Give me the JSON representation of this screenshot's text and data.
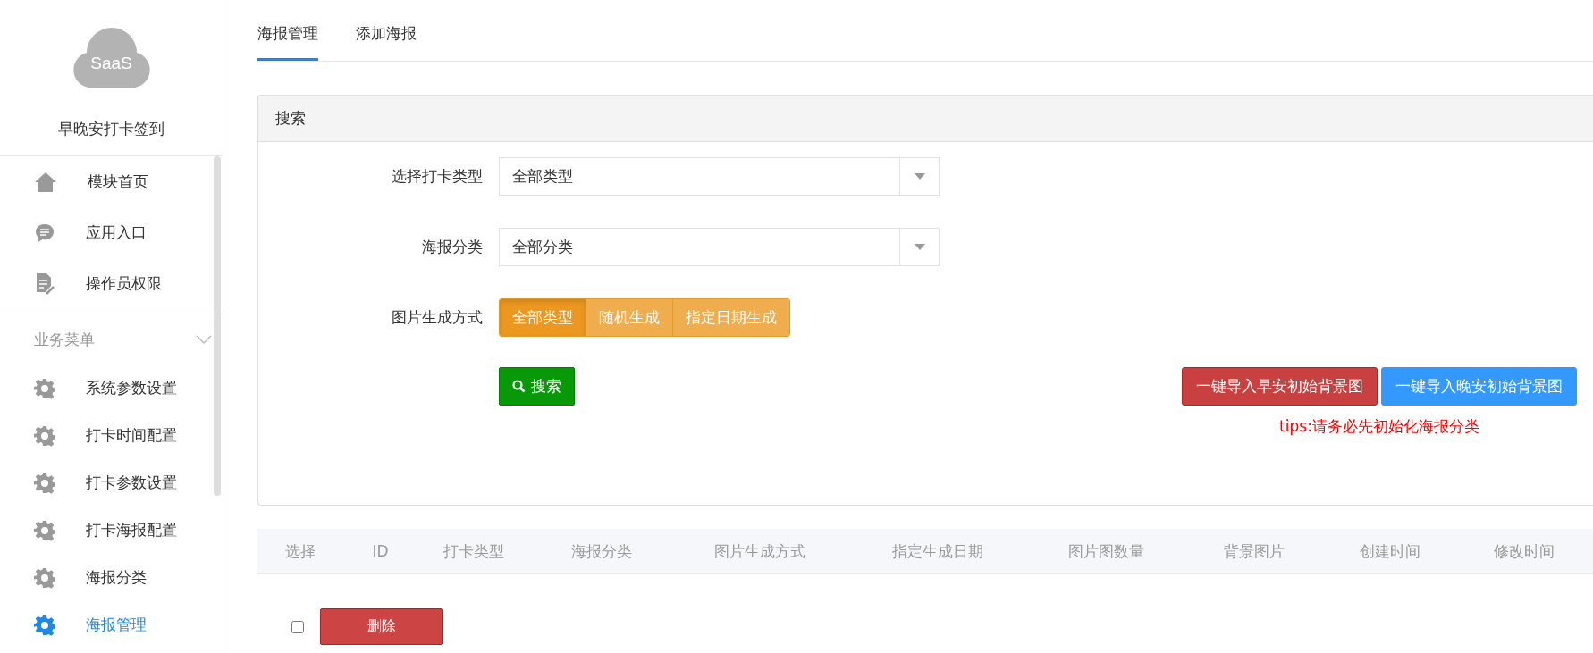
{
  "sidebar": {
    "logo_text": "SaaS",
    "app_name": "早晚安打卡签到",
    "main_items": [
      {
        "label": "模块首页",
        "kind": "home"
      },
      {
        "label": "应用入口",
        "kind": "chat"
      },
      {
        "label": "操作员权限",
        "kind": "doc"
      }
    ],
    "section": {
      "title": "业务菜单",
      "expanded": true,
      "items": [
        {
          "label": "系统参数设置",
          "selected": false
        },
        {
          "label": "打卡时间配置",
          "selected": false
        },
        {
          "label": "打卡参数设置",
          "selected": false
        },
        {
          "label": "打卡海报配置",
          "selected": false
        },
        {
          "label": "海报分类",
          "selected": false
        },
        {
          "label": "海报管理",
          "selected": true
        }
      ]
    }
  },
  "tabs": [
    {
      "label": "海报管理",
      "selected": true
    },
    {
      "label": "添加海报",
      "selected": false
    }
  ],
  "search_panel": {
    "title": "搜索",
    "fields": [
      {
        "label": "选择打卡类型",
        "value": "全部类型"
      },
      {
        "label": "海报分类",
        "value": "全部分类"
      }
    ],
    "generation": {
      "label": "图片生成方式",
      "options": [
        {
          "label": "全部类型",
          "selected": true
        },
        {
          "label": "随机生成",
          "selected": false
        },
        {
          "label": "指定日期生成",
          "selected": false
        }
      ]
    },
    "search_button": "搜索",
    "import_buttons": [
      {
        "label": "一键导入早安初始背景图",
        "kind": "danger"
      },
      {
        "label": "一键导入晚安初始背景图",
        "kind": "primary"
      }
    ],
    "tips": "tips:请务必先初始化海报分类"
  },
  "table": {
    "columns": [
      "选择",
      "ID",
      "打卡类型",
      "海报分类",
      "图片生成方式",
      "指定生成日期",
      "图片图数量",
      "背景图片",
      "创建时间",
      "修改时间"
    ],
    "select_all": {
      "checked": false
    },
    "delete_button": "删除"
  }
}
